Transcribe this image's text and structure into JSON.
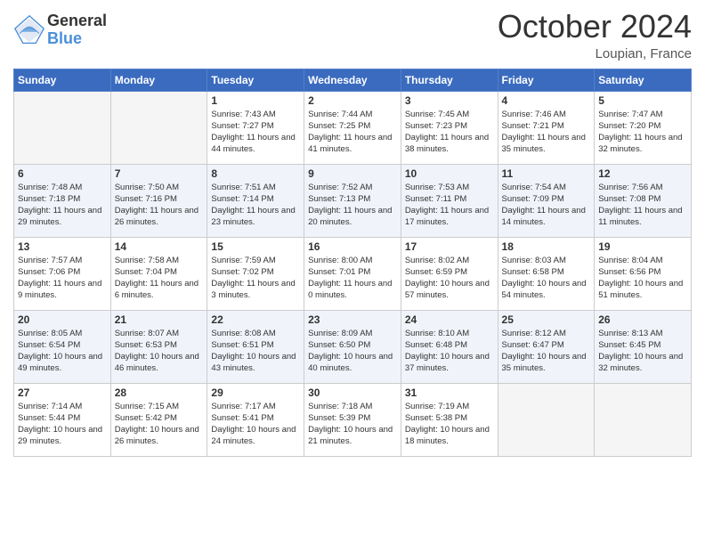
{
  "header": {
    "logo": {
      "general": "General",
      "blue": "Blue"
    },
    "title": "October 2024",
    "location": "Loupian, France"
  },
  "days_of_week": [
    "Sunday",
    "Monday",
    "Tuesday",
    "Wednesday",
    "Thursday",
    "Friday",
    "Saturday"
  ],
  "weeks": [
    [
      {
        "day": "",
        "empty": true
      },
      {
        "day": "",
        "empty": true
      },
      {
        "day": "1",
        "sunrise": "Sunrise: 7:43 AM",
        "sunset": "Sunset: 7:27 PM",
        "daylight": "Daylight: 11 hours and 44 minutes."
      },
      {
        "day": "2",
        "sunrise": "Sunrise: 7:44 AM",
        "sunset": "Sunset: 7:25 PM",
        "daylight": "Daylight: 11 hours and 41 minutes."
      },
      {
        "day": "3",
        "sunrise": "Sunrise: 7:45 AM",
        "sunset": "Sunset: 7:23 PM",
        "daylight": "Daylight: 11 hours and 38 minutes."
      },
      {
        "day": "4",
        "sunrise": "Sunrise: 7:46 AM",
        "sunset": "Sunset: 7:21 PM",
        "daylight": "Daylight: 11 hours and 35 minutes."
      },
      {
        "day": "5",
        "sunrise": "Sunrise: 7:47 AM",
        "sunset": "Sunset: 7:20 PM",
        "daylight": "Daylight: 11 hours and 32 minutes."
      }
    ],
    [
      {
        "day": "6",
        "sunrise": "Sunrise: 7:48 AM",
        "sunset": "Sunset: 7:18 PM",
        "daylight": "Daylight: 11 hours and 29 minutes."
      },
      {
        "day": "7",
        "sunrise": "Sunrise: 7:50 AM",
        "sunset": "Sunset: 7:16 PM",
        "daylight": "Daylight: 11 hours and 26 minutes."
      },
      {
        "day": "8",
        "sunrise": "Sunrise: 7:51 AM",
        "sunset": "Sunset: 7:14 PM",
        "daylight": "Daylight: 11 hours and 23 minutes."
      },
      {
        "day": "9",
        "sunrise": "Sunrise: 7:52 AM",
        "sunset": "Sunset: 7:13 PM",
        "daylight": "Daylight: 11 hours and 20 minutes."
      },
      {
        "day": "10",
        "sunrise": "Sunrise: 7:53 AM",
        "sunset": "Sunset: 7:11 PM",
        "daylight": "Daylight: 11 hours and 17 minutes."
      },
      {
        "day": "11",
        "sunrise": "Sunrise: 7:54 AM",
        "sunset": "Sunset: 7:09 PM",
        "daylight": "Daylight: 11 hours and 14 minutes."
      },
      {
        "day": "12",
        "sunrise": "Sunrise: 7:56 AM",
        "sunset": "Sunset: 7:08 PM",
        "daylight": "Daylight: 11 hours and 11 minutes."
      }
    ],
    [
      {
        "day": "13",
        "sunrise": "Sunrise: 7:57 AM",
        "sunset": "Sunset: 7:06 PM",
        "daylight": "Daylight: 11 hours and 9 minutes."
      },
      {
        "day": "14",
        "sunrise": "Sunrise: 7:58 AM",
        "sunset": "Sunset: 7:04 PM",
        "daylight": "Daylight: 11 hours and 6 minutes."
      },
      {
        "day": "15",
        "sunrise": "Sunrise: 7:59 AM",
        "sunset": "Sunset: 7:02 PM",
        "daylight": "Daylight: 11 hours and 3 minutes."
      },
      {
        "day": "16",
        "sunrise": "Sunrise: 8:00 AM",
        "sunset": "Sunset: 7:01 PM",
        "daylight": "Daylight: 11 hours and 0 minutes."
      },
      {
        "day": "17",
        "sunrise": "Sunrise: 8:02 AM",
        "sunset": "Sunset: 6:59 PM",
        "daylight": "Daylight: 10 hours and 57 minutes."
      },
      {
        "day": "18",
        "sunrise": "Sunrise: 8:03 AM",
        "sunset": "Sunset: 6:58 PM",
        "daylight": "Daylight: 10 hours and 54 minutes."
      },
      {
        "day": "19",
        "sunrise": "Sunrise: 8:04 AM",
        "sunset": "Sunset: 6:56 PM",
        "daylight": "Daylight: 10 hours and 51 minutes."
      }
    ],
    [
      {
        "day": "20",
        "sunrise": "Sunrise: 8:05 AM",
        "sunset": "Sunset: 6:54 PM",
        "daylight": "Daylight: 10 hours and 49 minutes."
      },
      {
        "day": "21",
        "sunrise": "Sunrise: 8:07 AM",
        "sunset": "Sunset: 6:53 PM",
        "daylight": "Daylight: 10 hours and 46 minutes."
      },
      {
        "day": "22",
        "sunrise": "Sunrise: 8:08 AM",
        "sunset": "Sunset: 6:51 PM",
        "daylight": "Daylight: 10 hours and 43 minutes."
      },
      {
        "day": "23",
        "sunrise": "Sunrise: 8:09 AM",
        "sunset": "Sunset: 6:50 PM",
        "daylight": "Daylight: 10 hours and 40 minutes."
      },
      {
        "day": "24",
        "sunrise": "Sunrise: 8:10 AM",
        "sunset": "Sunset: 6:48 PM",
        "daylight": "Daylight: 10 hours and 37 minutes."
      },
      {
        "day": "25",
        "sunrise": "Sunrise: 8:12 AM",
        "sunset": "Sunset: 6:47 PM",
        "daylight": "Daylight: 10 hours and 35 minutes."
      },
      {
        "day": "26",
        "sunrise": "Sunrise: 8:13 AM",
        "sunset": "Sunset: 6:45 PM",
        "daylight": "Daylight: 10 hours and 32 minutes."
      }
    ],
    [
      {
        "day": "27",
        "sunrise": "Sunrise: 7:14 AM",
        "sunset": "Sunset: 5:44 PM",
        "daylight": "Daylight: 10 hours and 29 minutes."
      },
      {
        "day": "28",
        "sunrise": "Sunrise: 7:15 AM",
        "sunset": "Sunset: 5:42 PM",
        "daylight": "Daylight: 10 hours and 26 minutes."
      },
      {
        "day": "29",
        "sunrise": "Sunrise: 7:17 AM",
        "sunset": "Sunset: 5:41 PM",
        "daylight": "Daylight: 10 hours and 24 minutes."
      },
      {
        "day": "30",
        "sunrise": "Sunrise: 7:18 AM",
        "sunset": "Sunset: 5:39 PM",
        "daylight": "Daylight: 10 hours and 21 minutes."
      },
      {
        "day": "31",
        "sunrise": "Sunrise: 7:19 AM",
        "sunset": "Sunset: 5:38 PM",
        "daylight": "Daylight: 10 hours and 18 minutes."
      },
      {
        "day": "",
        "empty": true
      },
      {
        "day": "",
        "empty": true
      }
    ]
  ]
}
